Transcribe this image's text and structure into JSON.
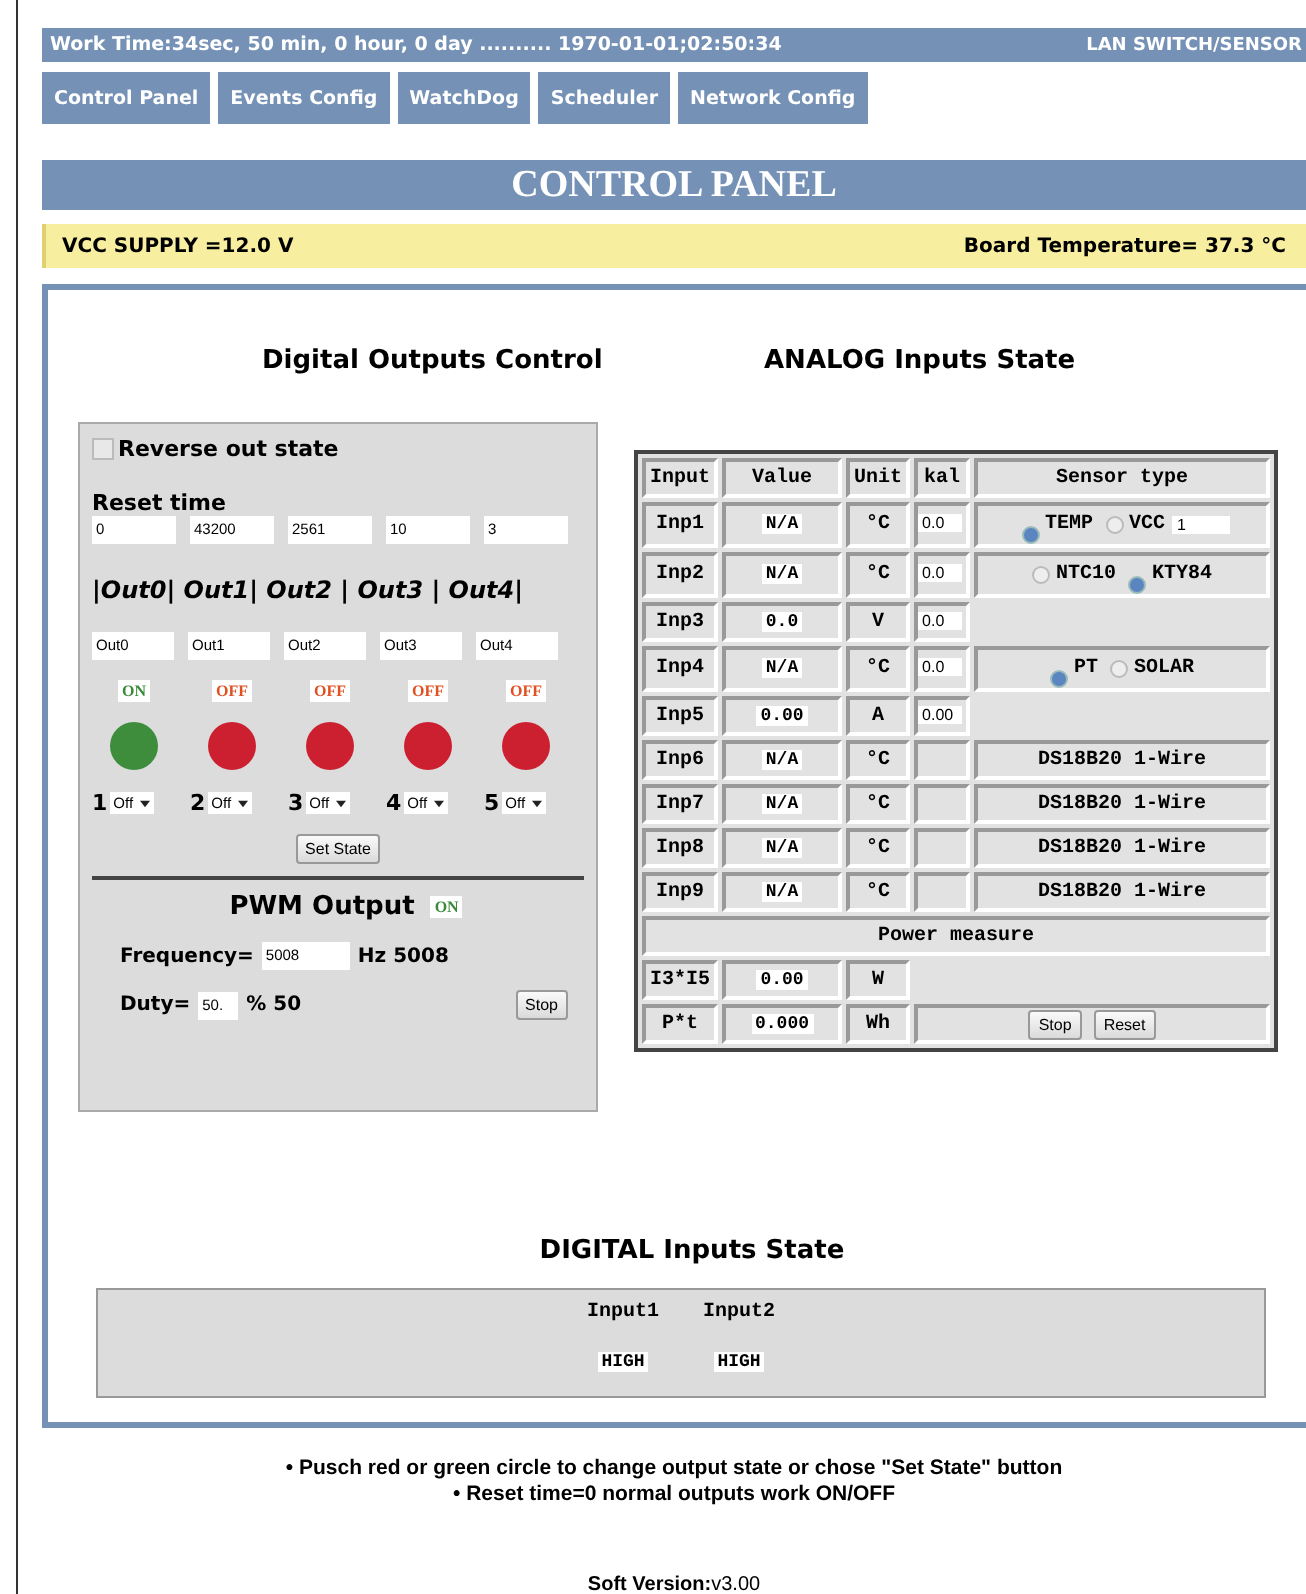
{
  "header": {
    "work_time": "Work Time:34sec, 50 min, 0 hour, 0 day .......... 1970-01-01;02:50:34",
    "device": "LAN SWITCH/SENSOR"
  },
  "tabs": [
    {
      "label": "Control Panel"
    },
    {
      "label": "Events Config"
    },
    {
      "label": "WatchDog"
    },
    {
      "label": "Scheduler"
    },
    {
      "label": "Network Config"
    }
  ],
  "title": "CONTROL PANEL",
  "supply": {
    "vcc": "VCC SUPPLY =12.0 V",
    "board_temp": "Board Temperature= 37.3 °C"
  },
  "digital_outputs": {
    "title": "Digital Outputs Control",
    "reverse": {
      "label": "Reverse out state",
      "checked": false
    },
    "reset_label": "Reset time",
    "reset_values": [
      "0",
      "43200",
      "2561",
      "10",
      "3"
    ],
    "out_header": "|Out0| Out1| Out2 | Out3 | Out4|",
    "outputs": [
      {
        "name": "Out0",
        "state": "ON",
        "on": true,
        "number": "1",
        "select": "Off"
      },
      {
        "name": "Out1",
        "state": "OFF",
        "on": false,
        "number": "2",
        "select": "Off"
      },
      {
        "name": "Out2",
        "state": "OFF",
        "on": false,
        "number": "3",
        "select": "Off"
      },
      {
        "name": "Out3",
        "state": "OFF",
        "on": false,
        "number": "4",
        "select": "Off"
      },
      {
        "name": "Out4",
        "state": "OFF",
        "on": false,
        "number": "5",
        "select": "Off"
      }
    ],
    "set_state": "Set State",
    "pwm": {
      "title": "PWM Output",
      "state": "ON",
      "on": true,
      "frequency_label": "Frequency=",
      "frequency": "5008",
      "frequency_unit": "Hz 5008",
      "duty_label": "Duty=",
      "duty": "50.",
      "duty_unit": "% 50",
      "button": "Stop"
    }
  },
  "analog": {
    "title": "ANALOG Inputs State",
    "columns": [
      "Input",
      "Value",
      "Unit",
      "kal",
      "Sensor type"
    ],
    "rows": [
      {
        "input": "Inp1",
        "value": "N/A",
        "unit": "°C",
        "kal": "0.0",
        "sensor": {
          "kind": "radios",
          "options": [
            {
              "label": "TEMP",
              "selected": true
            },
            {
              "label": "VCC",
              "selected": false
            }
          ],
          "field": "1"
        }
      },
      {
        "input": "Inp2",
        "value": "N/A",
        "unit": "°C",
        "kal": "0.0",
        "sensor": {
          "kind": "radios",
          "options": [
            {
              "label": "NTC10",
              "selected": false
            },
            {
              "label": "KTY84",
              "selected": true
            }
          ]
        }
      },
      {
        "input": "Inp3",
        "value": "0.0",
        "unit": "V",
        "kal": "0.0",
        "sensor": {
          "kind": "none"
        }
      },
      {
        "input": "Inp4",
        "value": "N/A",
        "unit": "°C",
        "kal": "0.0",
        "sensor": {
          "kind": "radios",
          "options": [
            {
              "label": "PT",
              "selected": true
            },
            {
              "label": "SOLAR",
              "selected": false
            }
          ]
        }
      },
      {
        "input": "Inp5",
        "value": "0.00",
        "unit": "A",
        "kal": "0.00",
        "sensor": {
          "kind": "none"
        }
      },
      {
        "input": "Inp6",
        "value": "N/A",
        "unit": "°C",
        "sensor": {
          "kind": "text",
          "text": "DS18B20 1-Wire"
        }
      },
      {
        "input": "Inp7",
        "value": "N/A",
        "unit": "°C",
        "sensor": {
          "kind": "text",
          "text": "DS18B20 1-Wire"
        }
      },
      {
        "input": "Inp8",
        "value": "N/A",
        "unit": "°C",
        "sensor": {
          "kind": "text",
          "text": "DS18B20 1-Wire"
        }
      },
      {
        "input": "Inp9",
        "value": "N/A",
        "unit": "°C",
        "sensor": {
          "kind": "text",
          "text": "DS18B20 1-Wire"
        }
      }
    ],
    "power": {
      "title": "Power measure",
      "rows": [
        {
          "input": "I3*I5",
          "value": "0.00",
          "unit": "W"
        },
        {
          "input": "P*t",
          "value": "0.000",
          "unit": "Wh"
        }
      ],
      "buttons": [
        "Stop",
        "Reset"
      ]
    }
  },
  "digital_inputs": {
    "title": "DIGITAL Inputs State",
    "inputs": [
      {
        "name": "Input1",
        "state": "HIGH"
      },
      {
        "name": "Input2",
        "state": "HIGH"
      }
    ]
  },
  "notes": [
    {
      "bullet": "•",
      "text": "Pusch red or green circle to change output state or chose \"Set State\" button"
    },
    {
      "bullet": "•",
      "text": "Reset time=0 normal outputs work ON/OFF"
    }
  ],
  "version": {
    "label": "Soft Version:",
    "value": "v3.00"
  }
}
